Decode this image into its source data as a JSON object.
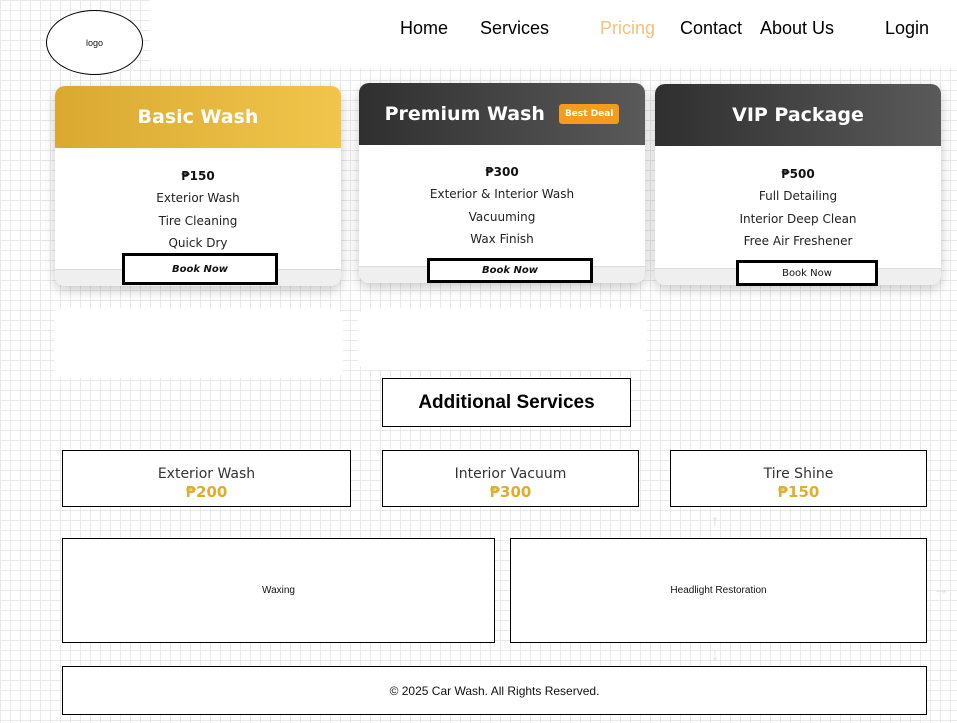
{
  "header": {
    "logo_text": "logo",
    "nav": [
      "Home",
      "Services",
      "Pricing",
      "Contact",
      "About Us"
    ],
    "active_nav": "Pricing",
    "login_label": "Login"
  },
  "pricing": [
    {
      "title": "Basic Wash",
      "badge": "",
      "price": "₱150",
      "features": [
        "Exterior Wash",
        "Tire Cleaning",
        "Quick Dry"
      ],
      "button": "Book Now"
    },
    {
      "title": "Premium Wash",
      "badge": "Best Deal",
      "price": "₱300",
      "features": [
        "Exterior & Interior Wash",
        "Vacuuming",
        "Wax Finish"
      ],
      "button": "Book Now"
    },
    {
      "title": "VIP Package",
      "badge": "",
      "price": "₱500",
      "features": [
        "Full Detailing",
        "Interior Deep Clean",
        "Free Air Freshener"
      ],
      "button": "Book Now"
    }
  ],
  "additional": {
    "title": "Additional Services",
    "services": [
      {
        "name": "Exterior Wash",
        "price": "₱200"
      },
      {
        "name": "Interior Vacuum",
        "price": "₱300"
      },
      {
        "name": "Tire Shine",
        "price": "₱150"
      }
    ],
    "extras": [
      "Waxing",
      "Headlight Restoration"
    ]
  },
  "footer": {
    "text": "© 2025 Car Wash. All Rights Reserved."
  },
  "colors": {
    "accent_gold": "#e0ad2f",
    "nav_active": "#f4c07f",
    "badge_orange": "#f59c1a",
    "dark_header": "#3a3a3a"
  },
  "icons": [
    "arrow-up-icon",
    "arrow-down-icon",
    "arrow-right-icon"
  ]
}
